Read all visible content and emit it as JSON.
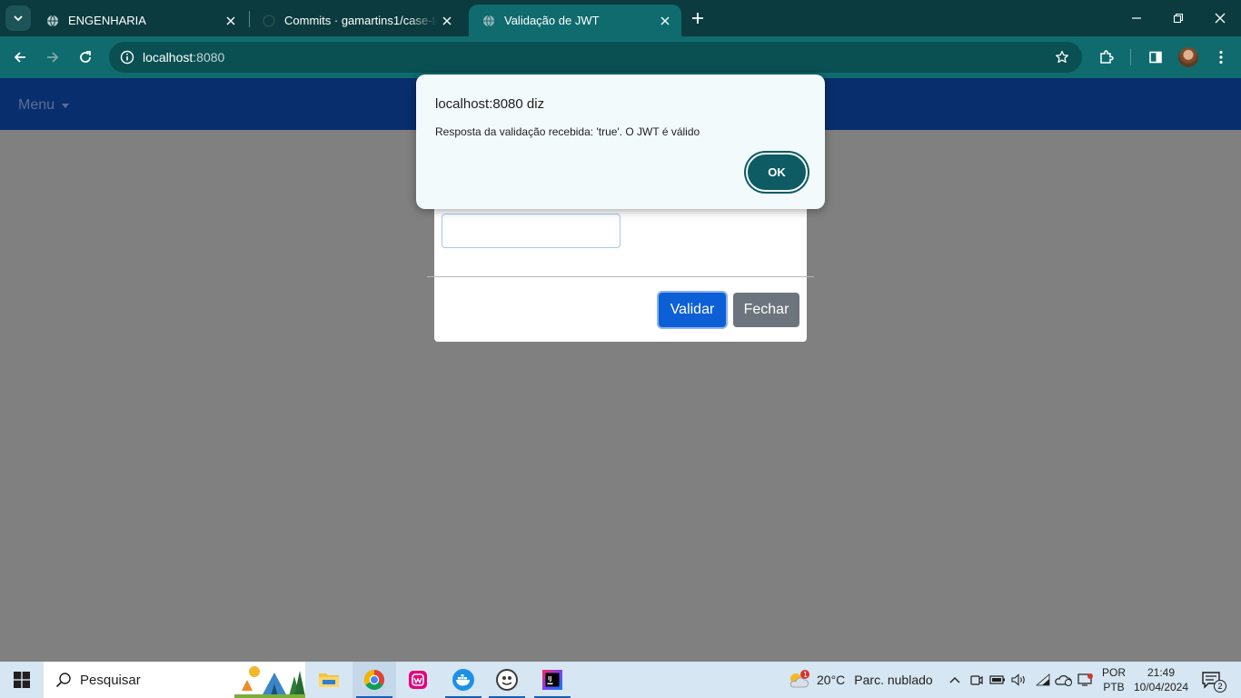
{
  "browser": {
    "tabs": [
      {
        "title": "ENGENHARIA",
        "active": false
      },
      {
        "title": "Commits · gamartins1/case-tecnico",
        "active": false
      },
      {
        "title": "Validação de JWT",
        "active": true
      }
    ],
    "address": {
      "host": "localhost",
      "port": ":8080"
    }
  },
  "page": {
    "menu_label": "Menu",
    "modal": {
      "jwt_input_value": "",
      "validate_label": "Validar",
      "close_label": "Fechar"
    }
  },
  "alert": {
    "title": "localhost:8080 diz",
    "message": "Resposta da validação recebida: 'true'. O JWT é válido",
    "ok_label": "OK"
  },
  "taskbar": {
    "search_placeholder": "Pesquisar",
    "weather": {
      "temp": "20°C",
      "description": "Parc. nublado",
      "alert_count": "1"
    },
    "language": {
      "lang": "POR",
      "layout": "PTB"
    },
    "time": "21:49",
    "date": "10/04/2024",
    "notifications_count": "2"
  },
  "colors": {
    "chrome_dark": "#0b3b3e",
    "chrome_toolbar": "#0f6b6e",
    "navbar": "#082e6d",
    "primary_button": "#0d5fd6",
    "secondary_button": "#6c757d",
    "alert_ok": "#0e5b63"
  }
}
